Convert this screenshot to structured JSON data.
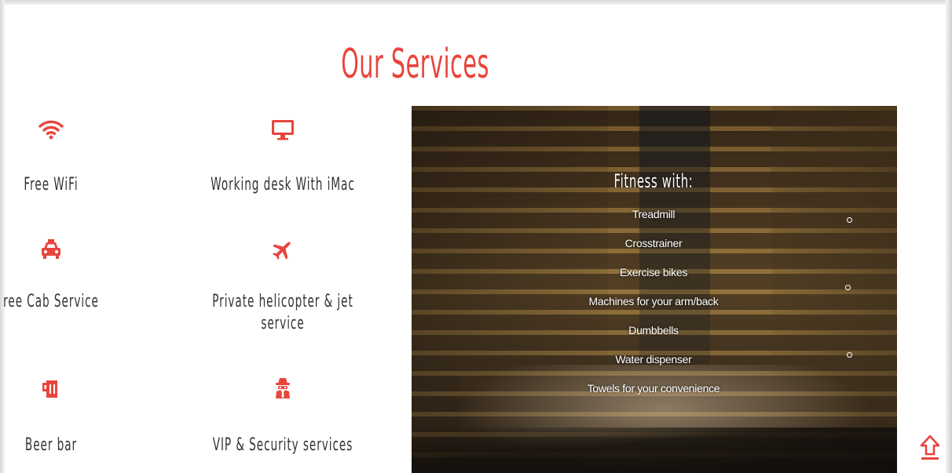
{
  "section": {
    "title": "Our Services"
  },
  "services": [
    {
      "label": "Free WiFi",
      "icon": "wifi-icon"
    },
    {
      "label": "Working desk With iMac",
      "icon": "desktop-monitor-icon"
    },
    {
      "label": "ree Cab Service",
      "icon": "taxi-icon"
    },
    {
      "label": "Private helicopter & jet",
      "label_line2": "service",
      "icon": "plane-icon"
    },
    {
      "label": "Beer bar",
      "icon": "beer-mug-icon"
    },
    {
      "label": "VIP & Security services",
      "icon": "spy-icon"
    }
  ],
  "fitness": {
    "title": "Fitness with:",
    "items": [
      "Treadmill",
      "Crosstrainer",
      "Exercise bikes",
      "Machines for your arm/back",
      "Dumbbells",
      "Water dispenser",
      "Towels for your convenience"
    ]
  },
  "colors": {
    "accent": "#e8453c",
    "text": "#333333",
    "overlay_text": "#ffffff"
  },
  "controls": {
    "scroll_top_icon": "arrow-up-icon"
  }
}
